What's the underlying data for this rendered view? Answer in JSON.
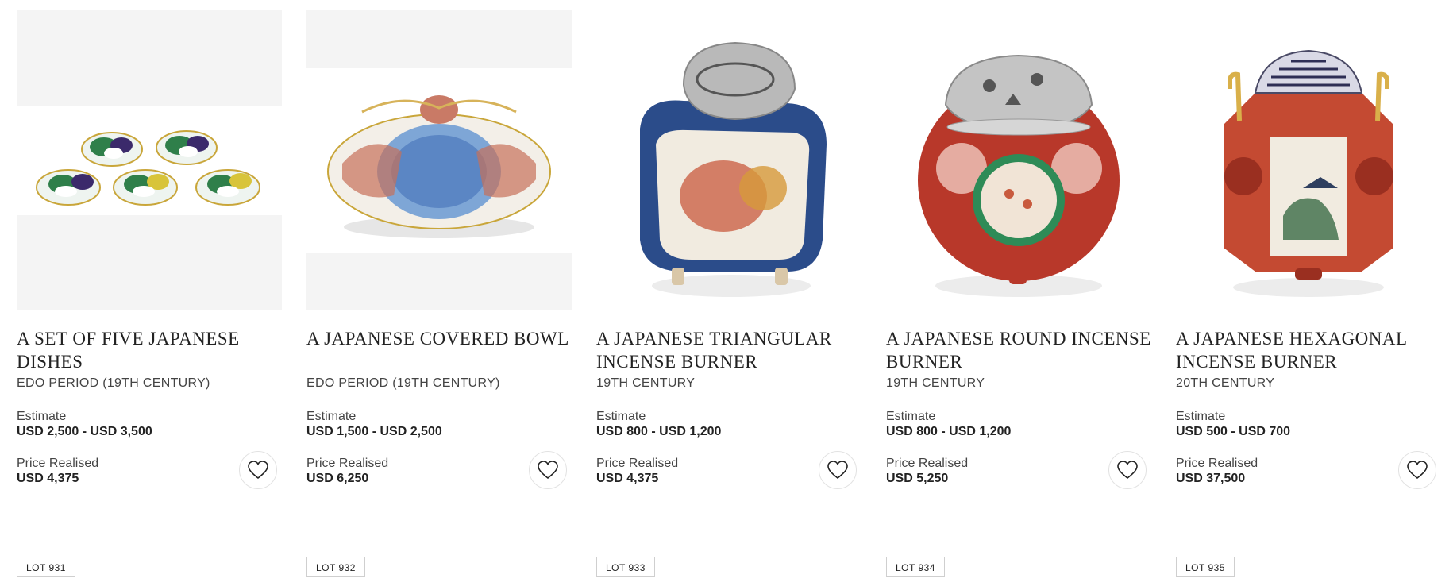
{
  "lots": [
    {
      "title": "A SET OF FIVE JAPANESE DISHES",
      "period": "EDO PERIOD (19TH CENTURY)",
      "estimate_label": "Estimate",
      "estimate": "USD 2,500 - USD 3,500",
      "price_label": "Price Realised",
      "price": "USD 4,375",
      "lot": "LOT 931"
    },
    {
      "title": "A JAPANESE COVERED BOWL",
      "period": "EDO PERIOD (19TH CENTURY)",
      "estimate_label": "Estimate",
      "estimate": "USD 1,500 - USD 2,500",
      "price_label": "Price Realised",
      "price": "USD 6,250",
      "lot": "LOT 932"
    },
    {
      "title": "A JAPANESE TRIANGULAR INCENSE BURNER",
      "period": "19TH CENTURY",
      "estimate_label": "Estimate",
      "estimate": "USD 800 - USD 1,200",
      "price_label": "Price Realised",
      "price": "USD 4,375",
      "lot": "LOT 933"
    },
    {
      "title": "A JAPANESE ROUND INCENSE BURNER",
      "period": "19TH CENTURY",
      "estimate_label": "Estimate",
      "estimate": "USD 800 - USD 1,200",
      "price_label": "Price Realised",
      "price": "USD 5,250",
      "lot": "LOT 934"
    },
    {
      "title": "A JAPANESE HEXAGONAL INCENSE BURNER",
      "period": "20TH CENTURY",
      "estimate_label": "Estimate",
      "estimate": "USD 500 - USD 700",
      "price_label": "Price Realised",
      "price": "USD 37,500",
      "lot": "LOT 935"
    }
  ],
  "icons": {
    "favorite": "heart-outline-icon"
  },
  "colors": {
    "placeholder_band": "#f4f4f4",
    "text": "#222222",
    "border": "#cfcfcf"
  }
}
